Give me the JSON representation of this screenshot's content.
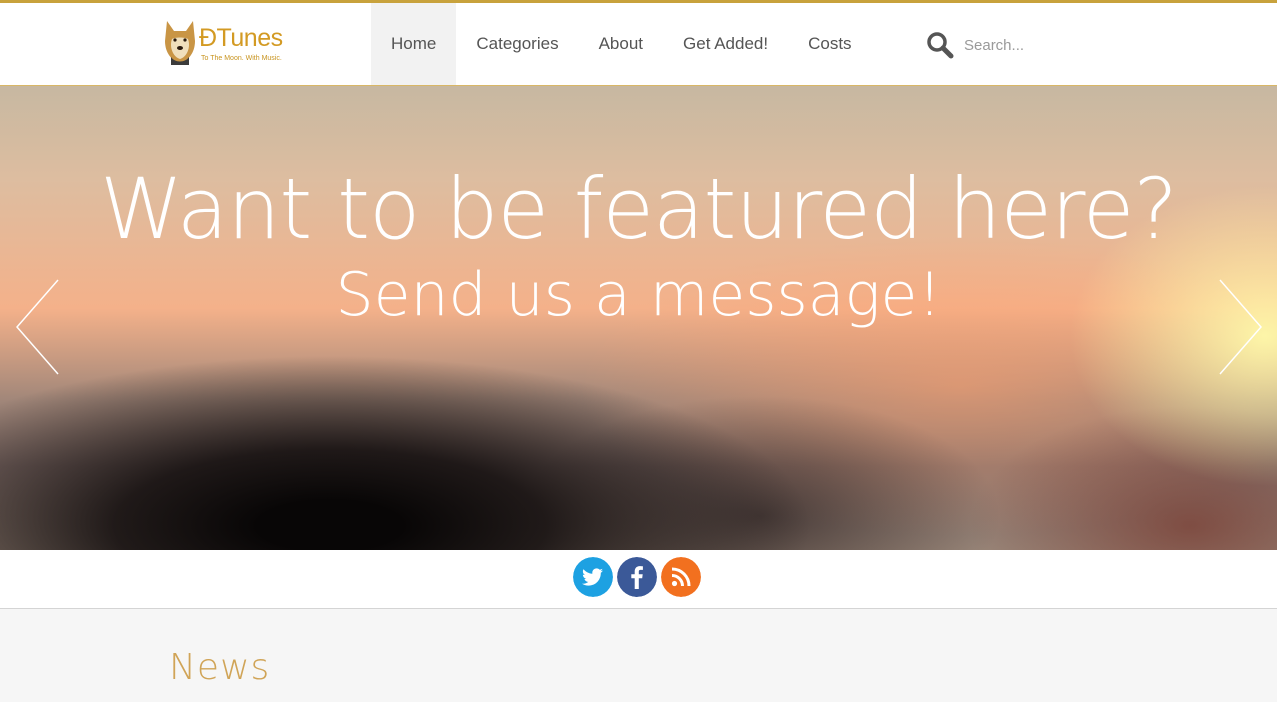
{
  "brand": {
    "name": "ĐTunes",
    "tagline": "To The Moon. With Music.",
    "accent_color": "#d39a23"
  },
  "nav": {
    "items": [
      {
        "label": "Home",
        "active": true
      },
      {
        "label": "Categories",
        "active": false
      },
      {
        "label": "About",
        "active": false
      },
      {
        "label": "Get Added!",
        "active": false
      },
      {
        "label": "Costs",
        "active": false
      }
    ]
  },
  "search": {
    "placeholder": "Search...",
    "icon": "search-icon"
  },
  "hero": {
    "title": "Want to be featured here?",
    "subtitle": "Send us a message!",
    "prev_icon": "chevron-left-icon",
    "next_icon": "chevron-right-icon"
  },
  "social": {
    "items": [
      {
        "name": "twitter",
        "icon": "twitter-icon",
        "color": "#1da1e2"
      },
      {
        "name": "facebook",
        "icon": "facebook-icon",
        "color": "#3b5998"
      },
      {
        "name": "rss",
        "icon": "rss-icon",
        "color": "#f2701f"
      }
    ]
  },
  "news": {
    "title": "News",
    "title_color": "#d0a457"
  }
}
